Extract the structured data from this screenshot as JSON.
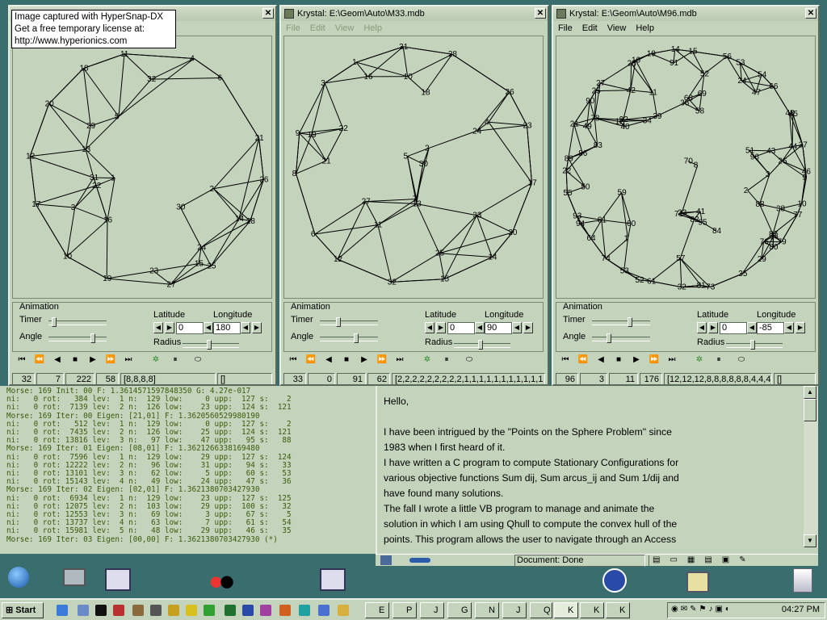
{
  "hypersnap": {
    "line1": "Image captured with HyperSnap-DX",
    "line2": "Get a free temporary license at:",
    "line3": "http://www.hyperionics.com"
  },
  "windows": [
    {
      "title": "",
      "menu": [],
      "timer": "Timer",
      "angle": "Angle",
      "animation": "Animation",
      "latitude_label": "Latitude",
      "longitude_label": "Longitude",
      "radius": "Radius",
      "latitude": "0",
      "longitude": "180",
      "status": [
        "32",
        "7",
        "222",
        "58",
        "[8,8,8,8]",
        "[]"
      ]
    },
    {
      "title": "Krystal: E:\\Geom\\Auto\\M33.mdb",
      "menu": [
        "File",
        "Edit",
        "View",
        "Help"
      ],
      "timer": "Timer",
      "angle": "Angle",
      "animation": "Animation",
      "latitude_label": "Latitude",
      "longitude_label": "Longitude",
      "radius": "Radius",
      "latitude": "0",
      "longitude": "90",
      "status": [
        "33",
        "0",
        "91",
        "62",
        "[2,2,2,2,2,2,2,2,2,1,1,1,1,1,1,1,1,1,1,1",
        "]"
      ]
    },
    {
      "title": "Krystal: E:\\Geom\\Auto\\M96.mdb",
      "menu": [
        "File",
        "Edit",
        "View",
        "Help"
      ],
      "timer": "Timer",
      "angle": "Angle",
      "animation": "Animation",
      "latitude_label": "Latitude",
      "longitude_label": "Longitude",
      "radius": "Radius",
      "latitude": "0",
      "longitude": "-85",
      "status": [
        "96",
        "3",
        "11",
        "176",
        "[12,12,12,8,8,8,8,8,8,4,4,4]",
        "[]"
      ]
    }
  ],
  "labels": {
    "w1": [
      "26",
      "28",
      "25",
      "27",
      "19",
      "10",
      "17",
      "12",
      "20",
      "18",
      "11",
      "4",
      "6",
      "21",
      "3",
      "5",
      "15",
      "22",
      "13",
      "24",
      "16",
      "14",
      "23",
      "31",
      "29",
      "32",
      "30",
      "1",
      "2"
    ],
    "w2": [
      "17",
      "20",
      "14",
      "15",
      "32",
      "12",
      "6",
      "8",
      "9",
      "3",
      "1",
      "31",
      "28",
      "26",
      "23",
      "24",
      "21",
      "22",
      "27",
      "25",
      "30",
      "2",
      "11",
      "4",
      "5",
      "7",
      "10",
      "33",
      "13",
      "18",
      "19",
      "16"
    ],
    "w3": [
      "9",
      "10",
      "77",
      "79",
      "80",
      "29",
      "35",
      "73",
      "81",
      "32",
      "61",
      "52",
      "53",
      "74",
      "64",
      "94",
      "93",
      "55",
      "22",
      "89",
      "21",
      "90",
      "25",
      "27",
      "28",
      "16",
      "19",
      "14",
      "15",
      "56",
      "53",
      "54",
      "66",
      "48",
      "45",
      "37",
      "46",
      "38",
      "39",
      "47",
      "40",
      "68",
      "26",
      "76",
      "71",
      "42",
      "43",
      "49",
      "41",
      "50",
      "8",
      "51",
      "44",
      "52",
      "57",
      "58",
      "60",
      "59",
      "23",
      "88",
      "24",
      "91",
      "95",
      "69",
      "86",
      "87",
      "92",
      "96",
      "33",
      "34",
      "81",
      "83",
      "82",
      "84",
      "36",
      "11",
      "12",
      "2",
      "1",
      "3",
      "70",
      "78"
    ]
  },
  "console": [
    "Morse: 169 Init: 00 F: 1.3614571597848350 G: 4.27e-017",
    "ni:   0 rot:   384 lev:  1 n:  129 low:     0 upp:  127 s:    2",
    "ni:   0 rot:  7139 lev:  2 n:  126 low:    23 upp:  124 s:  121",
    "Morse: 169 Iter: 00 Eigen: [21,01] F: 1.3620560529980190",
    "ni:   0 rot:   512 lev:  1 n:  129 low:     0 upp:  127 s:    2",
    "ni:   0 rot:  7435 lev:  2 n:  126 low:    25 upp:  124 s:  121",
    "ni:   0 rot: 13816 lev:  3 n:   97 low:    47 upp:   95 s:   88",
    "Morse: 169 Iter: 01 Eigen: [08,01] F: 1.3621266338169480",
    "ni:   0 rot:  7596 lev:  1 n:  129 low:    29 upp:  127 s:  124",
    "ni:   0 rot: 12222 lev:  2 n:   96 low:    31 upp:   94 s:   33",
    "ni:   0 rot: 13101 lev:  3 n:   62 low:     5 upp:   60 s:   53",
    "ni:   0 rot: 15143 lev:  4 n:   49 low:    24 upp:   47 s:   36",
    "Morse: 169 Iter: 02 Eigen: [02,01] F: 1.3621380703427930",
    "ni:   0 rot:  6934 lev:  1 n:  129 low:    23 upp:  127 s:  125",
    "ni:   0 rot: 12075 lev:  2 n:  103 low:    29 upp:  100 s:   32",
    "ni:   0 rot: 12553 lev:  3 n:   69 low:     3 upp:   67 s:    5",
    "ni:   0 rot: 13737 lev:  4 n:   63 low:     7 upp:   61 s:   54",
    "ni:   0 rot: 15981 lev:  5 n:   48 low:    29 upp:   46 s:   35",
    "Morse: 169 Iter: 03 Eigen: [00,00] F: 1.3621380703427930 (*)"
  ],
  "browser": {
    "lines": [
      "Hello,",
      "I have been intrigued by the \"Points on the Sphere Problem\" since",
      "1983  when I first heard of it.",
      "I have written a C program to compute Stationary Configurations for",
      "various objective functions Sum dij, Sum arcus_ij and Sum 1/dij and",
      "have found many solutions.",
      "The fall I wrote a little VB program to manage and animate the",
      "solution in which I am using Qhull to compute the convex hull of the",
      "points. This program allows the user to navigate through an Access"
    ],
    "status": "Document: Done"
  },
  "taskbar": {
    "start": "Start",
    "clock": "04:27 PM",
    "tasks": [
      "E",
      "P",
      "J",
      "G",
      "N",
      "J",
      "Q",
      "K",
      "K",
      "K"
    ]
  },
  "colors": {
    "desktop": "#3a6e6e",
    "window": "#c4d4bc",
    "console_text": "#3a5a0a"
  }
}
